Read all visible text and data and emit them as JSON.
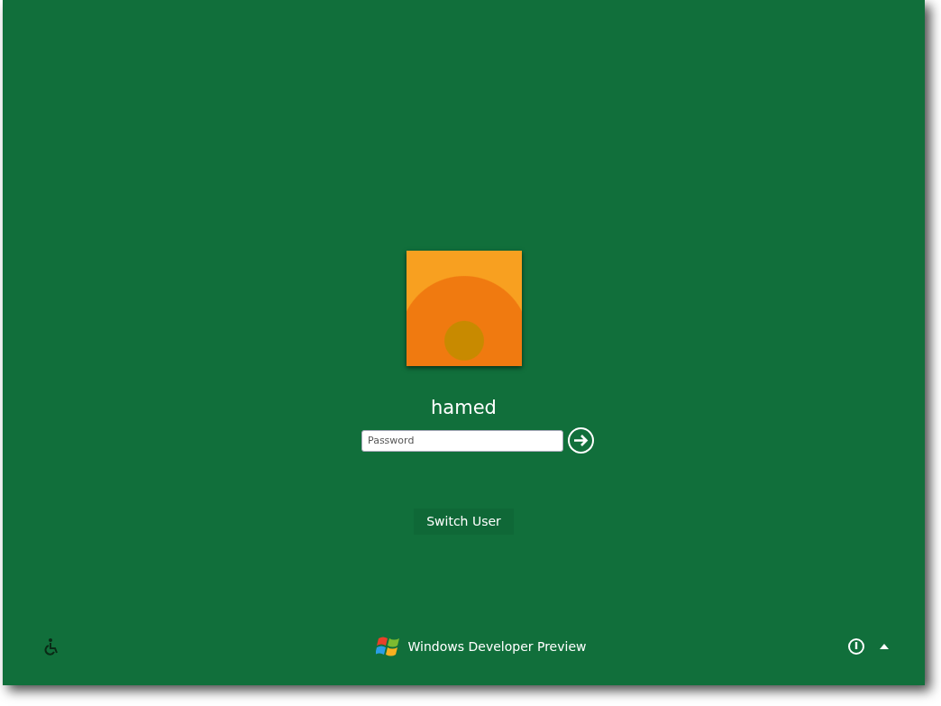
{
  "user": {
    "name": "hamed"
  },
  "password": {
    "placeholder": "Password"
  },
  "switch_user": {
    "label": "Switch User"
  },
  "footer": {
    "brand": "Windows Developer Preview"
  }
}
